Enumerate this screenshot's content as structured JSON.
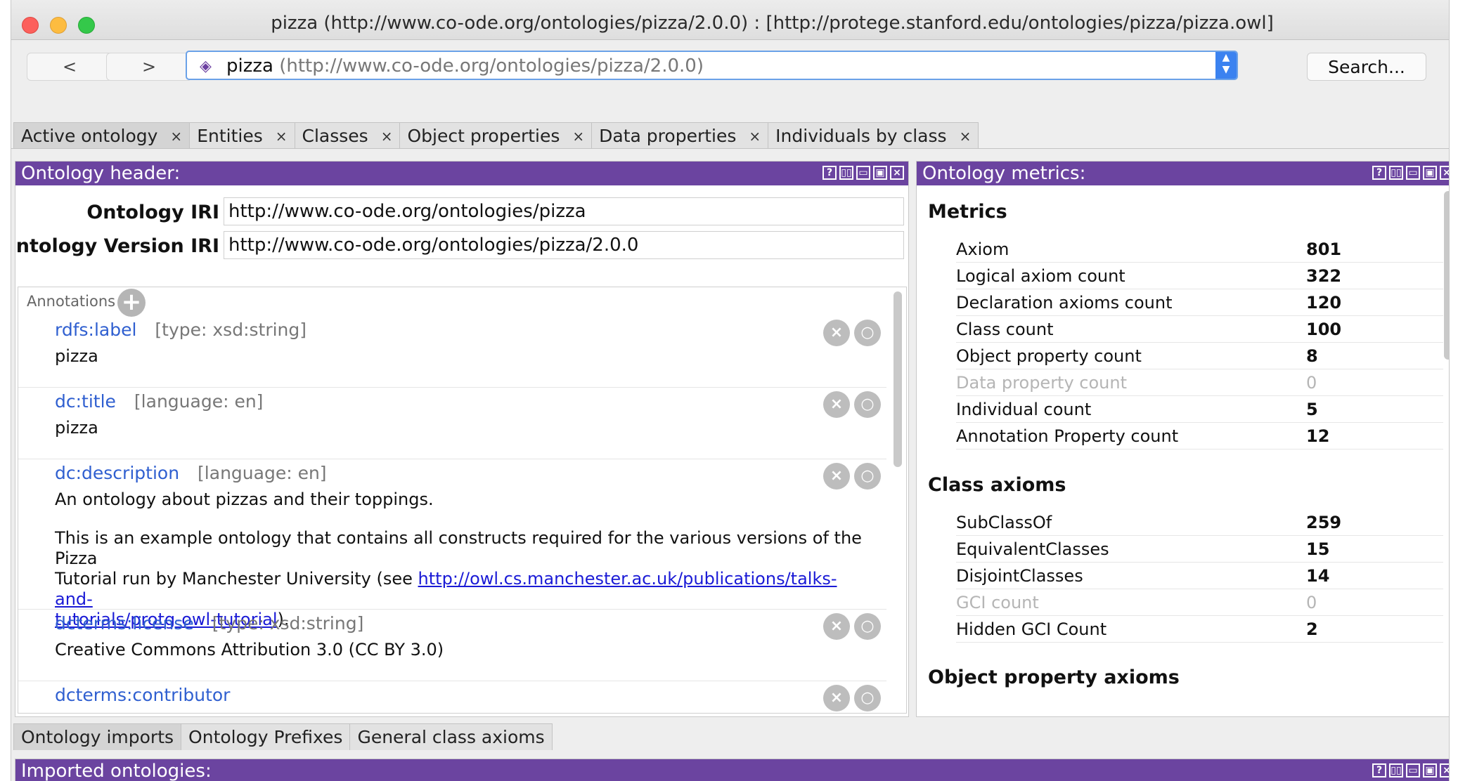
{
  "window": {
    "title": "pizza (http://www.co-ode.org/ontologies/pizza/2.0.0)  : [http://protege.stanford.edu/ontologies/pizza/pizza.owl]"
  },
  "toolbar": {
    "back_label": "<",
    "forward_label": ">",
    "ontology_name": "pizza",
    "ontology_iri": "(http://www.co-ode.org/ontologies/pizza/2.0.0)",
    "search_label": "Search..."
  },
  "tabs": [
    {
      "label": "Active ontology",
      "close": "×"
    },
    {
      "label": "Entities",
      "close": "×"
    },
    {
      "label": "Classes",
      "close": "×"
    },
    {
      "label": "Object properties",
      "close": "×"
    },
    {
      "label": "Data properties",
      "close": "×"
    },
    {
      "label": "Individuals by class",
      "close": "×"
    }
  ],
  "header_panel": {
    "title": "Ontology header:",
    "iri_label": "Ontology IRI",
    "iri_value": "http://www.co-ode.org/ontologies/pizza",
    "version_label": "Ontology Version IRI",
    "version_value": "http://www.co-ode.org/ontologies/pizza/2.0.0",
    "annotations_label": "Annotations",
    "annotations": [
      {
        "prop": "rdfs:label",
        "type": "[type: xsd:string]",
        "value": "pizza"
      },
      {
        "prop": "dc:title",
        "type": "[language: en]",
        "value": "pizza"
      },
      {
        "prop": "dc:description",
        "type": "[language: en]",
        "value_line1": "An ontology about pizzas and their toppings.",
        "value_line2a": "This is an example ontology that contains all constructs required for the various versions of the Pizza",
        "value_line2b": "Tutorial run by Manchester University (see ",
        "link_part1": "http://owl.cs.manchester.ac.uk/publications/talks-and-",
        "link_part2": "tutorials/protg-owl-tutorial",
        "value_end": ")."
      },
      {
        "prop": "dcterms:license",
        "type": "[type: xsd:string]",
        "value": "Creative Commons Attribution 3.0 (CC BY 3.0)"
      },
      {
        "prop": "dcterms:contributor",
        "type": ""
      }
    ]
  },
  "metrics_panel": {
    "title": "Ontology metrics:",
    "sections": [
      {
        "title": "Metrics",
        "rows": [
          {
            "k": "Axiom",
            "v": "801"
          },
          {
            "k": "Logical axiom count",
            "v": "322"
          },
          {
            "k": "Declaration axioms count",
            "v": "120"
          },
          {
            "k": "Class count",
            "v": "100"
          },
          {
            "k": "Object property count",
            "v": "8"
          },
          {
            "k": "Data property count",
            "v": "0"
          },
          {
            "k": "Individual count",
            "v": "5"
          },
          {
            "k": "Annotation Property count",
            "v": "12"
          }
        ]
      },
      {
        "title": "Class axioms",
        "rows": [
          {
            "k": "SubClassOf",
            "v": "259"
          },
          {
            "k": "EquivalentClasses",
            "v": "15"
          },
          {
            "k": "DisjointClasses",
            "v": "14"
          },
          {
            "k": "GCI count",
            "v": "0"
          },
          {
            "k": "Hidden GCI Count",
            "v": "2"
          }
        ]
      },
      {
        "title": "Object property axioms",
        "rows": []
      }
    ]
  },
  "bottom_tabs": [
    {
      "label": "Ontology imports"
    },
    {
      "label": "Ontology Prefixes"
    },
    {
      "label": "General class axioms"
    }
  ],
  "imports_panel": {
    "title": "Imported ontologies:"
  },
  "panel_buttons": [
    "?",
    "▯▯",
    "▭",
    "▣",
    "×"
  ],
  "colors": {
    "header_purple": "#6b44a0",
    "link_blue": "#2f5fd0",
    "accent": "#3b82f0"
  }
}
